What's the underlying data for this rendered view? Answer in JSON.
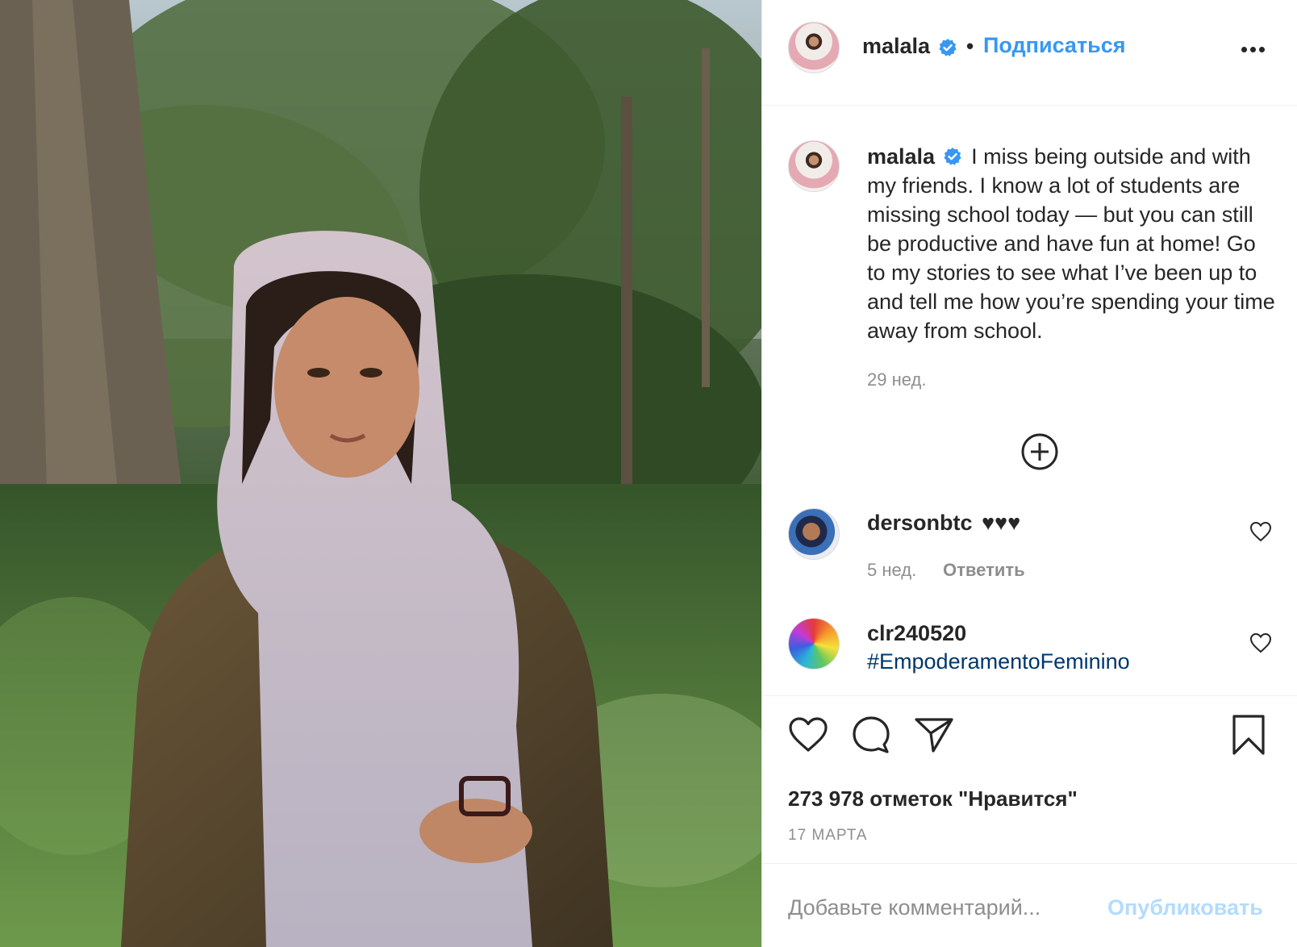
{
  "header": {
    "username": "malala",
    "separator": "•",
    "follow_label": "Подписаться"
  },
  "caption": {
    "username": "malala",
    "text": "I miss being outside and with my friends. I know a lot of students are missing school today — but you can still be productive and have fun at home! Go to my stories to see what I’ve been up to and tell me how you’re spending your time away from school.",
    "time": "29 нед."
  },
  "comments": [
    {
      "username": "dersonbtc",
      "text": "♥♥♥",
      "time": "5 нед.",
      "reply_label": "Ответить"
    },
    {
      "username": "clr240520",
      "text": "#EmpoderamentoFeminino"
    }
  ],
  "actions": {
    "likes": "273 978 отметок \"Нравится\"",
    "date": "17 МАРТА"
  },
  "comment_box": {
    "placeholder": "Добавьте комментарий...",
    "publish_label": "Опубликовать"
  },
  "colors": {
    "accent": "#3897f0",
    "verified": "#3897f0",
    "publish_disabled": "#b3dbff",
    "hashtag": "#00376b",
    "muted": "#8e8e8e"
  },
  "icons": [
    "verified-badge-icon",
    "more-options-icon",
    "plus-circle-icon",
    "heart-icon",
    "comment-icon",
    "share-icon",
    "bookmark-icon"
  ]
}
